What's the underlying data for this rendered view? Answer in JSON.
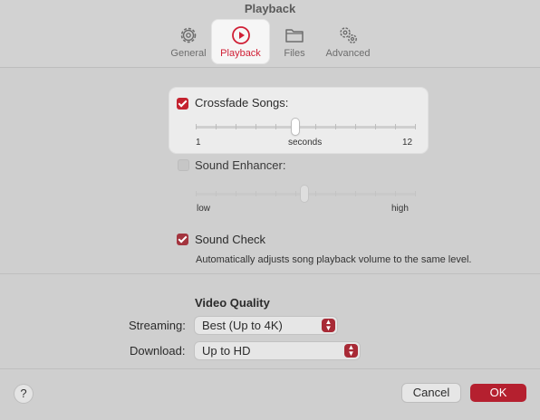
{
  "window": {
    "title": "Playback"
  },
  "tabs": [
    {
      "label": "General",
      "icon": "gear-icon",
      "active": false
    },
    {
      "label": "Playback",
      "icon": "play-circle-icon",
      "active": true
    },
    {
      "label": "Files",
      "icon": "folder-icon",
      "active": false
    },
    {
      "label": "Advanced",
      "icon": "gears-icon",
      "active": false
    }
  ],
  "crossfade": {
    "label": "Crossfade Songs:",
    "checked": true,
    "slider": {
      "min_label": "1",
      "mid_label": "seconds",
      "max_label": "12",
      "value": 6
    }
  },
  "sound_enhancer": {
    "label": "Sound Enhancer:",
    "checked": false,
    "slider": {
      "min_label": "low",
      "max_label": "high",
      "value_fraction": 0.5
    }
  },
  "sound_check": {
    "label": "Sound Check",
    "checked": true,
    "description": "Automatically adjusts song playback volume to the same level."
  },
  "video_quality": {
    "heading": "Video Quality",
    "streaming": {
      "label": "Streaming:",
      "value": "Best (Up to 4K)"
    },
    "download": {
      "label": "Download:",
      "value": "Up to HD"
    }
  },
  "footer": {
    "help": "?",
    "cancel": "Cancel",
    "ok": "OK"
  },
  "colors": {
    "accent": "#c4222f",
    "ok_button": "#b5202f",
    "background": "#cfcfcf"
  }
}
